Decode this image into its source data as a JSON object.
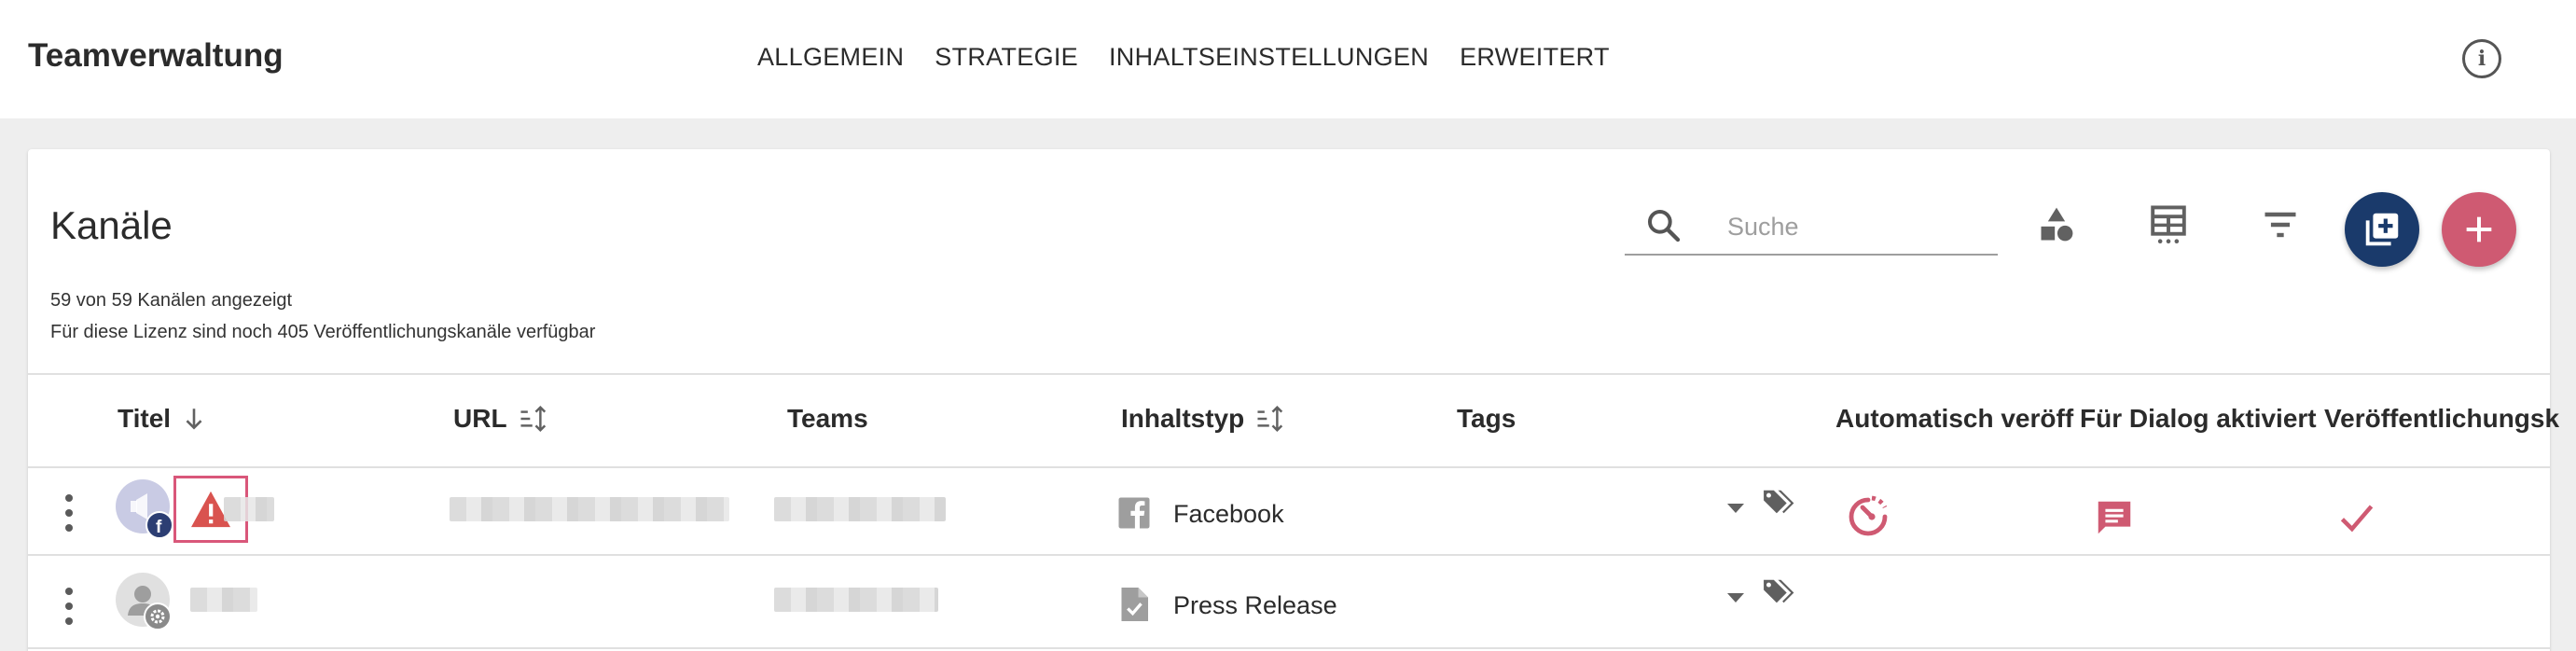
{
  "app": {
    "title": "Teamverwaltung",
    "nav": [
      "ALLGEMEIN",
      "STRATEGIE",
      "INHALTSEINSTELLUNGEN",
      "ERWEITERT"
    ]
  },
  "card": {
    "title": "Kanäle",
    "info_line1": "59 von 59 Kanälen angezeigt",
    "info_line2": "Für diese Lizenz sind noch 405 Veröffentlichungskanäle verfügbar"
  },
  "search": {
    "placeholder": "Suche",
    "value": ""
  },
  "columns": [
    "Titel",
    "URL",
    "Teams",
    "Inhaltstyp",
    "Tags",
    "Automatisch veröff",
    "Für Dialog aktiviert",
    "Veröffentlichungsk"
  ],
  "rows": [
    {
      "type": "Facebook",
      "has_warning": true,
      "auto_publish": true,
      "dialog_enabled": true,
      "publishing": true
    },
    {
      "type": "Press Release",
      "has_warning": false,
      "auto_publish": false,
      "dialog_enabled": false,
      "publishing": false
    }
  ],
  "colors": {
    "accent": "#cf5a72",
    "primary_fab": "#1a3a6b",
    "warning": "#d9534f",
    "warning_frame": "#d9577a"
  },
  "icons": [
    "info-icon",
    "search-icon",
    "shapes-icon",
    "table-columns-icon",
    "filter-icon",
    "add-library-icon",
    "plus-icon",
    "sort-arrow-icon",
    "sort-icon",
    "kebab-icon",
    "warning-icon",
    "facebook-icon",
    "document-check-icon",
    "dropdown-caret-icon",
    "tag-icon",
    "timer-icon",
    "chat-icon",
    "check-icon"
  ]
}
